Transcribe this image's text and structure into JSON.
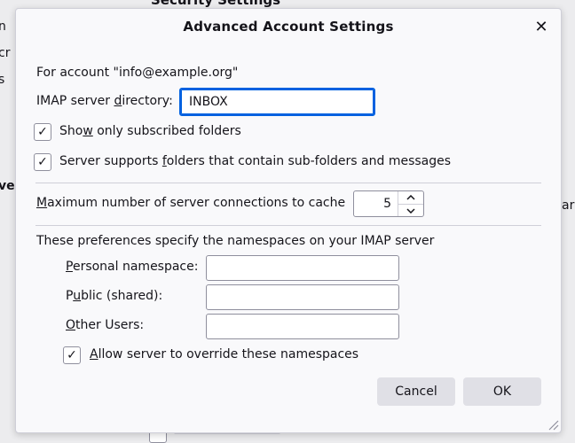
{
  "background": {
    "title": "Security Settings",
    "left_fragments": [
      "n",
      "cr",
      "s",
      "ve"
    ],
    "right_fragment": "ar"
  },
  "dialog": {
    "title": "Advanced Account Settings",
    "close_glyph": "✕",
    "account_line": "For account \"info@example.org\"",
    "imap_dir": {
      "label_pre": "IMAP server ",
      "label_u": "d",
      "label_post": "irectory:",
      "value": "INBOX"
    },
    "subscribed": {
      "label_pre": "Sho",
      "label_u": "w",
      "label_post": " only subscribed folders",
      "checked": true
    },
    "subfolders": {
      "label_pre": "Server supports ",
      "label_u": "f",
      "label_post": "olders that contain sub-folders and messages",
      "checked": true
    },
    "max_conn": {
      "label_u": "M",
      "label_post": "aximum number of server connections to cache",
      "value": "5"
    },
    "namespaces_heading": "These preferences specify the namespaces on your IMAP server",
    "personal": {
      "label_u": "P",
      "label_post": "ersonal namespace:",
      "value": ""
    },
    "public": {
      "label_pre": "P",
      "label_u": "u",
      "label_post": "blic (shared):",
      "value": ""
    },
    "other": {
      "label_u": "O",
      "label_post": "ther Users:",
      "value": ""
    },
    "override": {
      "label_u": "A",
      "label_post": "llow server to override these namespaces",
      "checked": true
    },
    "cancel_label": "Cancel",
    "ok_label": "OK",
    "check_glyph": "✓"
  },
  "colors": {
    "focus": "#0061e0",
    "button": "#e0e0e6",
    "dialog_bg": "#f9f9fb"
  }
}
